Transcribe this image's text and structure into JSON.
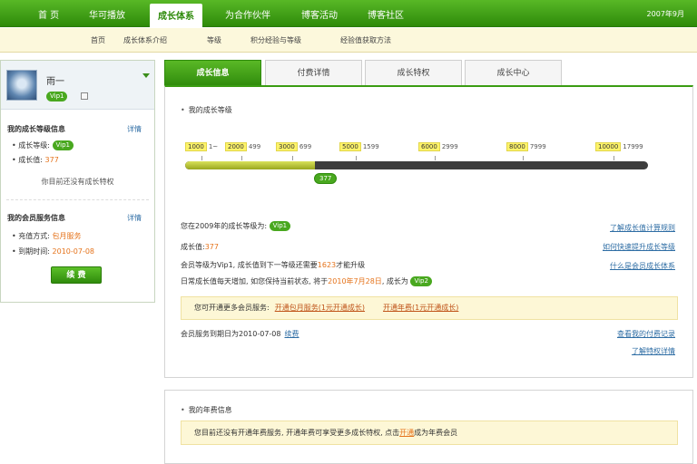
{
  "topnav": {
    "items": [
      "首 页",
      "华可播放",
      "成长体系",
      "为合作伙伴",
      "博客活动",
      "博客社区"
    ],
    "right_text": "2007年9月"
  },
  "subnav": {
    "items": [
      "首页",
      "成长体系介绍",
      "等级",
      "积分经验与等级",
      "经验值获取方法"
    ]
  },
  "sidebar": {
    "user_name": "雨一",
    "user_badge": "Vip1",
    "growth_section": {
      "title": "我的成长等级信息",
      "link": "详情",
      "level_label": "成长等级:",
      "level_badge": "Vip1",
      "value_label": "成长值:",
      "value": "377",
      "note": "你目前还没有成长特权"
    },
    "service_section": {
      "title": "我的会员服务信息",
      "link": "详情",
      "method_label": "充值方式:",
      "method_value": "包月服务",
      "expire_label": "到期时间:",
      "expire_value": "2010-07-08",
      "button": "续 费"
    }
  },
  "tabs": [
    "成长信息",
    "付费详情",
    "成长特权",
    "成长中心"
  ],
  "growth_panel": {
    "title": "我的成长等级",
    "markers": [
      {
        "value": "1000",
        "label": "1~"
      },
      {
        "value": "2000",
        "label": "499"
      },
      {
        "value": "3000",
        "label": "699"
      },
      {
        "value": "5000",
        "label": "1599"
      },
      {
        "value": "6000",
        "label": "2999"
      },
      {
        "value": "8000",
        "label": "7999"
      },
      {
        "value": "10000",
        "label": "17999"
      }
    ],
    "progress_fraction": 0.28,
    "current_badge": "377",
    "row1": {
      "text": "您在2009年的成长等级为:",
      "badge": "Vip1",
      "link": "了解成长值计算规则"
    },
    "row2": {
      "label": "成长值:",
      "value": "377",
      "link": "如何快速提升成长等级"
    },
    "row3": {
      "pre": "会员等级为Vip1, 成长值到下一等级还需要",
      "value": "1623",
      "post": "才能升级",
      "link": "什么是会员成长体系"
    },
    "row4": {
      "pre": "日常成长值每天增加, 如您保持当前状态, 将于",
      "date": "2010年7月28日",
      "post": ", 成长为",
      "badge": "Vip2"
    },
    "note": {
      "text": "您可开通更多会员服务:",
      "link1": "开通包月服务(1元开通成长)",
      "link2": "开通年费(1元开通成长)"
    },
    "row5": {
      "text": "会员服务到期日为2010-07-08",
      "link": "续费",
      "right_link1": "查看我的付费记录",
      "right_link2": "了解特权详情"
    }
  },
  "annual_panel": {
    "title": "我的年费信息",
    "pre": "您目前还没有开通年费服务, 开通年费可享受更多成长特权, 点击",
    "link": "开通",
    "post": "成为年费会员"
  },
  "colors": {
    "brand_green": "#3a9c12",
    "accent_orange": "#e5731b",
    "note_bg": "#fdf7d6"
  }
}
